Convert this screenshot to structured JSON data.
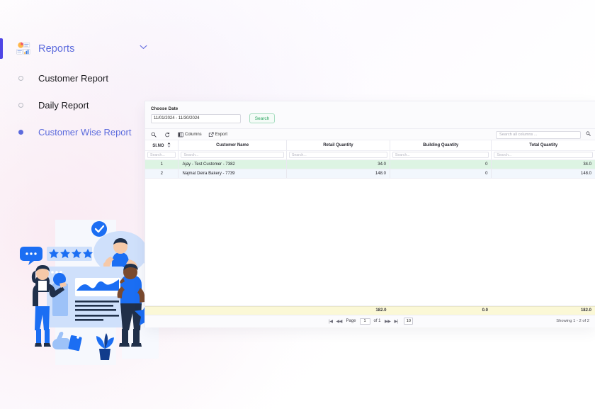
{
  "sidebar": {
    "header": {
      "label": "Reports",
      "icon": "reports-chart-icon",
      "chevron": "chevron-down-icon"
    },
    "items": [
      {
        "label": "Customer Report",
        "active": false
      },
      {
        "label": "Daily Report",
        "active": false
      },
      {
        "label": "Customer Wise Report",
        "active": true
      }
    ],
    "accent_color": "#4f46e5",
    "active_color": "#5c6bdd"
  },
  "illustration": {
    "name": "customer-feedback-illustration",
    "primary_color": "#1b6ef3"
  },
  "panel": {
    "filters": {
      "choose_date_label": "Choose Date",
      "date_range_value": "11/01/2024 - 11/30/2024",
      "search_button": "Search"
    },
    "toolbar": {
      "search_icon": "search-icon",
      "refresh_icon": "refresh-icon",
      "columns_label": "Columns",
      "columns_icon": "columns-icon",
      "export_label": "Export",
      "export_icon": "export-icon",
      "global_search_placeholder": "Search all columns ...",
      "global_search_icon": "search-icon"
    },
    "table": {
      "columns": [
        "Sl.NO",
        "Customer Name",
        "Retail Quantity",
        "Building Quantity",
        "Total Quantity"
      ],
      "sorted_column": "Sl.NO",
      "filter_placeholder": "Search...",
      "rows": [
        {
          "slno": "1",
          "customer": "Ajay - Test Customer - 7382",
          "retail": "34.0",
          "building": "0",
          "total": "34.0"
        },
        {
          "slno": "2",
          "customer": "Najmat Deira Bakery - 7739",
          "retail": "148.0",
          "building": "0",
          "total": "148.0"
        }
      ],
      "totals": {
        "retail": "182.0",
        "building": "0.0",
        "total": "182.0"
      },
      "row_colors": {
        "row1": "#ddf4e3",
        "row2": "#f2f7fd",
        "totals": "#fbf8d6"
      }
    },
    "pagination": {
      "first_icon": "first-page-icon",
      "prev_icon": "previous-page-icon",
      "page_label": "Page",
      "page_value": "1",
      "of_label": "of 1",
      "next_icon": "next-page-icon",
      "last_icon": "last-page-icon",
      "page_size": "10",
      "showing": "Showing 1 - 2 of 2"
    }
  }
}
